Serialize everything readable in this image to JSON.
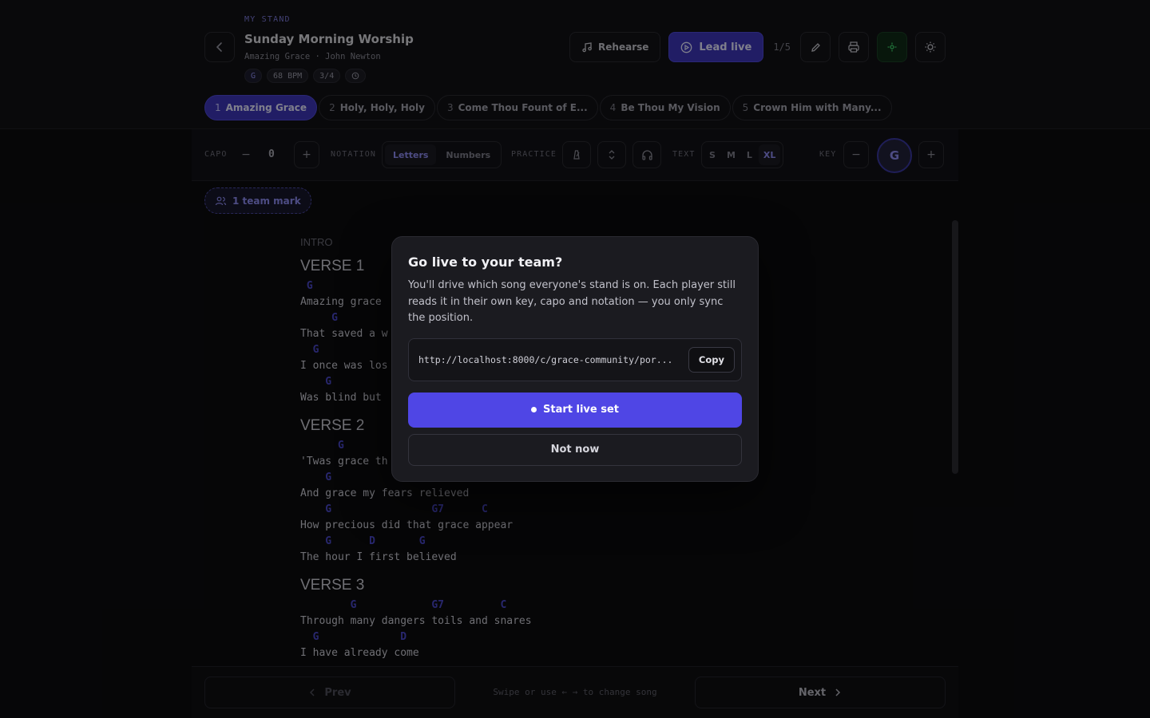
{
  "header": {
    "eyebrow": "MY STAND",
    "title": "Sunday Morning Worship",
    "subtitle": "Amazing Grace · John Newton",
    "chips": {
      "key": "G",
      "bpm": "68 BPM",
      "time": "3/4"
    },
    "rehearse_label": "Rehearse",
    "lead_label": "Lead live",
    "counter": "1/5"
  },
  "tabs": [
    {
      "num": "1",
      "label": "Amazing Grace"
    },
    {
      "num": "2",
      "label": "Holy, Holy, Holy"
    },
    {
      "num": "3",
      "label": "Come Thou Fount of E..."
    },
    {
      "num": "4",
      "label": "Be Thou My Vision"
    },
    {
      "num": "5",
      "label": "Crown Him with Many..."
    }
  ],
  "toolbar": {
    "capo_label": "CAPO",
    "capo_value": "0",
    "notation_label": "NOTATION",
    "notation_letters": "Letters",
    "notation_numbers": "Numbers",
    "practice_label": "PRACTICE",
    "text_label": "TEXT",
    "text_s": "S",
    "text_m": "M",
    "text_l": "L",
    "text_xl": "XL",
    "key_label": "KEY",
    "key_value": "G"
  },
  "team_mark": "1 team mark",
  "song": {
    "intro": "INTRO",
    "v1_title": "VERSE 1",
    "v1": [
      " G",
      "Amazing grace",
      "     G",
      "That saved a w",
      "  G",
      "I once was los",
      "    G",
      "Was blind but"
    ],
    "v2_title": "VERSE 2",
    "v2": [
      "      G",
      "'Twas grace th",
      "    G               D",
      "And grace my fears relieved",
      "    G                G7      C",
      "How precious did that grace appear",
      "    G      D       G",
      "The hour I first believed"
    ],
    "v3_title": "VERSE 3",
    "v3": [
      "        G            G7         C",
      "Through many dangers toils and snares",
      "  G             D",
      "I have already come"
    ]
  },
  "footer": {
    "prev": "Prev",
    "hint": "Swipe or use ← → to change song",
    "next": "Next"
  },
  "modal": {
    "title": "Go live to your team?",
    "body": "You'll drive which song everyone's stand is on. Each player still reads it in their own key, capo and notation — you only sync the position.",
    "link": "http://localhost:8000/c/grace-community/por...",
    "copy_label": "Copy",
    "start_label": "Start live set",
    "dismiss_label": "Not now"
  },
  "colors": {
    "accent": "#4f46e5",
    "chord": "#4a48c8",
    "live_green": "#3cd26a"
  }
}
